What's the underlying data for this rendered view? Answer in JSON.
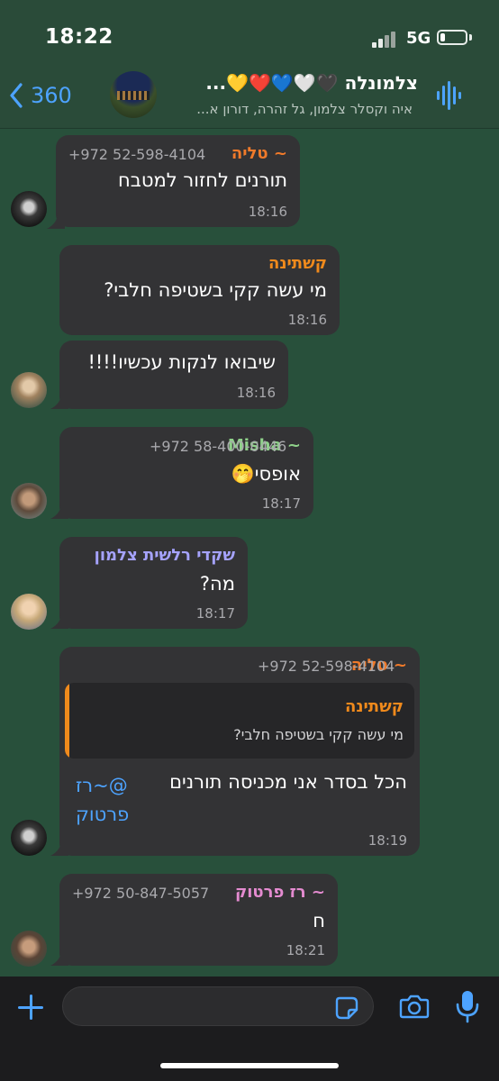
{
  "status_bar": {
    "time": "18:22",
    "network": "5G",
    "battery_level": 0.2
  },
  "header": {
    "back_count": "360",
    "title": "צלמונלה 🖤🤍💙❤️💛...",
    "subtitle": "איה וקסלר צלמון, גל זהרה, דורון א...",
    "icons": {
      "back": "chevron-left-icon",
      "audio": "waveform-icon"
    }
  },
  "messages": [
    {
      "sender": "~ טליה",
      "sender_color": "#f07a2a",
      "phone": "+972 52-598-4104",
      "text": "תורנים לחזור למטבח",
      "time": "18:16"
    },
    {
      "sender": "קשתינה",
      "sender_color": "#f08a1c",
      "phone": "",
      "text": "מי עשה קקי בשטיפה חלבי?",
      "time": "18:16"
    },
    {
      "sender": "",
      "sender_color": "",
      "phone": "",
      "text": "שיבואו לנקות עכשיו!!!!",
      "time": "18:16"
    },
    {
      "sender": "~ Misha",
      "sender_color": "#8fd18a",
      "phone": "+972 58-400-0446",
      "text": "אופסי🤭",
      "time": "18:17"
    },
    {
      "sender": "שקדי רלשית צלמון",
      "sender_color": "#a6a3ff",
      "phone": "",
      "text": "מה?",
      "time": "18:17"
    },
    {
      "sender": "~ טליה",
      "sender_color": "#f07a2a",
      "phone": "+972 52-598-4104",
      "quote": {
        "sender": "קשתינה",
        "text": "מי עשה קקי בשטיפה חלבי?"
      },
      "text": "הכל בסדר אני מכניסה תורנים",
      "mention": "@~רז פרטוק",
      "time": "18:19"
    },
    {
      "sender": "~ רז פרטוק",
      "sender_color": "#e48bd0",
      "phone": "+972 50-847-5057",
      "text": "ח",
      "time": "18:21"
    }
  ],
  "input_bar": {
    "placeholder": "",
    "icons": [
      "plus-icon",
      "sticker-icon",
      "camera-icon",
      "microphone-icon"
    ]
  },
  "colors": {
    "accent": "#4da3ff",
    "chat_background": "#28503b",
    "bubble": "#333335"
  }
}
